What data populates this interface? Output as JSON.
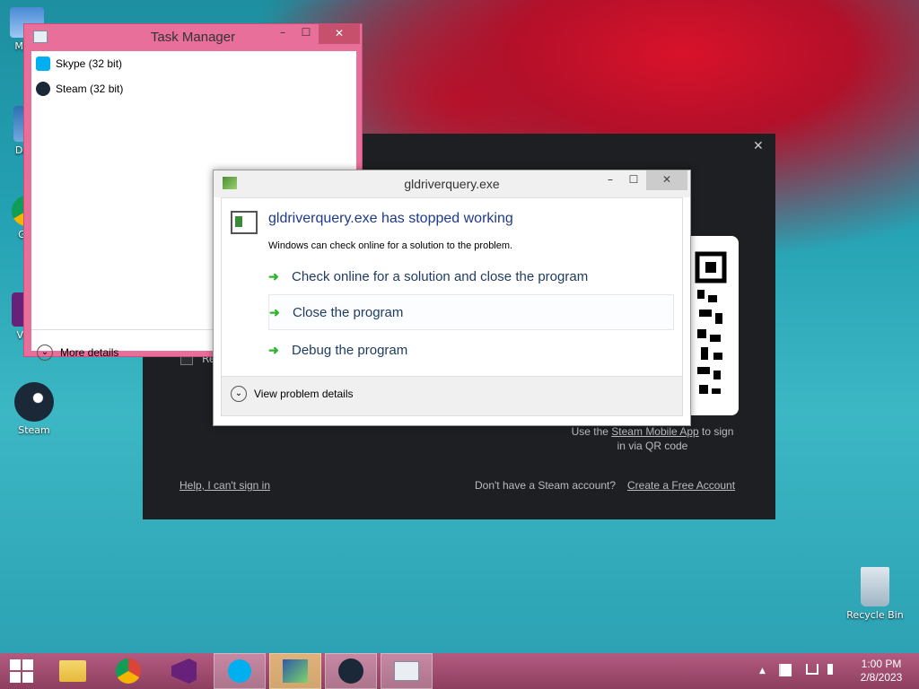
{
  "desktop": {
    "icons": [
      {
        "label": "My C",
        "name": "my-computer"
      },
      {
        "label": "Data",
        "name": "data"
      },
      {
        "label": "G C",
        "name": "google-chrome"
      },
      {
        "label": "Visu",
        "name": "visual-studio"
      },
      {
        "label": "Steam",
        "name": "steam"
      },
      {
        "label": "Recycle Bin",
        "name": "recycle-bin"
      }
    ]
  },
  "task_manager": {
    "title": "Task Manager",
    "apps": [
      {
        "label": "Skype (32 bit)",
        "icon": "skype-icon"
      },
      {
        "label": "Steam (32 bit)",
        "icon": "steam-icon"
      }
    ],
    "more_details": "More details",
    "caption_buttons": {
      "min": "–",
      "max": "☐",
      "close": "✕"
    }
  },
  "steam_login": {
    "close": "✕",
    "qr_caption_pre": "Use the",
    "qr_caption_link": "Steam Mobile App",
    "qr_caption_post": "to sign",
    "qr_caption_line2": "in via QR code",
    "help_link": "Help, I can't sign in",
    "no_account": "Don't have a Steam account?",
    "create_link": "Create a Free Account",
    "remember_partial": "Re"
  },
  "error_dialog": {
    "title": "gldriverquery.exe",
    "heading": "gldriverquery.exe has stopped working",
    "subtext": "Windows can check online for a solution to the problem.",
    "options": [
      "Check online for a solution and close the program",
      "Close the program",
      "Debug the program"
    ],
    "view_details": "View problem details",
    "caption_buttons": {
      "min": "–",
      "max": "☐",
      "close": "✕"
    }
  },
  "taskbar": {
    "start": "start-icon",
    "apps": [
      "file-explorer",
      "chrome",
      "visual-studio",
      "skype",
      "app-verifier",
      "steam",
      "problem-reporting"
    ],
    "time": "1:00 PM",
    "date": "2/8/2023",
    "tray_up": "▲"
  },
  "colors": {
    "taskmanager_frame": "#e76f9a",
    "taskbar": "#9e4d6e",
    "steam_bg": "#1e1f23",
    "dialog_heading": "#1e3a5f",
    "arrow_green": "#2eb52e"
  }
}
